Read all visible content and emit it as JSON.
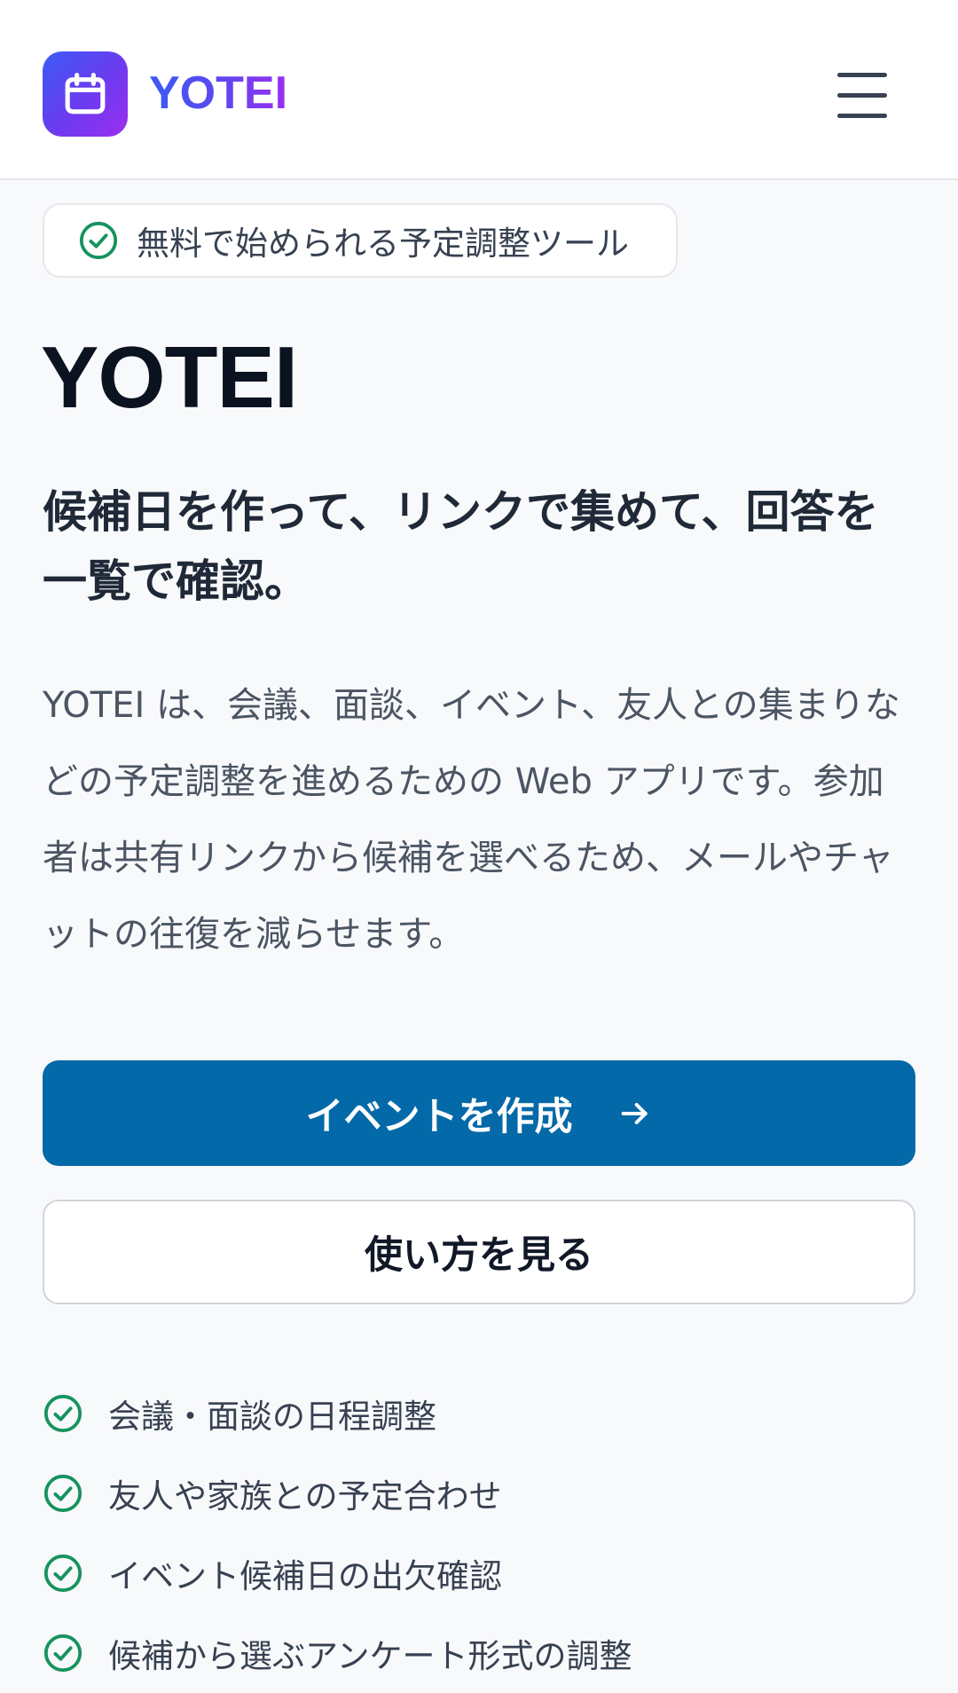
{
  "header": {
    "brand": "YOTEI",
    "logo_icon": "calendar-icon",
    "menu_icon": "hamburger-menu-icon"
  },
  "badge": {
    "text": "無料で始められる予定調整ツール",
    "icon": "check-circle-icon"
  },
  "hero": {
    "title": "YOTEI",
    "subtitle": "候補日を作って、リンクで集めて、回答を一覧で確認。",
    "description": "YOTEI は、会議、面談、イベント、友人との集まりなどの予定調整を進めるための Web アプリです。参加者は共有リンクから候補を選べるため、メールやチャットの往復を減らせます。"
  },
  "actions": {
    "primary_label": "イベントを作成",
    "primary_icon": "arrow-right-icon",
    "secondary_label": "使い方を見る"
  },
  "features": [
    "会議・面談の日程調整",
    "友人や家族との予定合わせ",
    "イベント候補日の出欠確認",
    "候補から選ぶアンケート形式の調整"
  ],
  "colors": {
    "primary": "#0369a8",
    "check_green": "#16935f",
    "brand_gradient_start": "#3b5bf6",
    "brand_gradient_end": "#9b2ff0"
  }
}
